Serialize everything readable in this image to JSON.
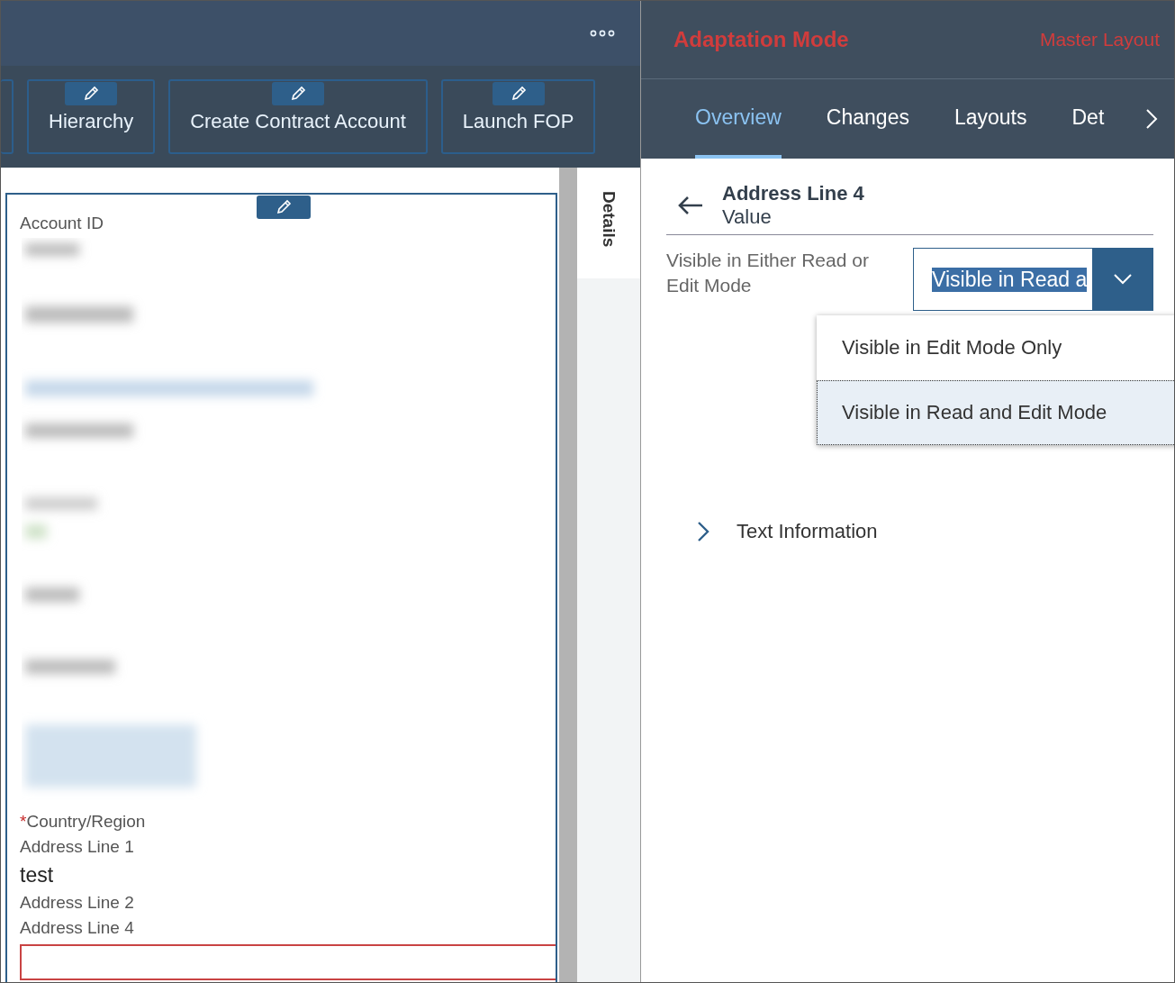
{
  "toolbar": {
    "buttons": [
      {
        "label": "Hierarchy"
      },
      {
        "label": "Create Contract Account"
      },
      {
        "label": "Launch FOP"
      }
    ]
  },
  "card": {
    "fields": [
      {
        "kind": "label",
        "text": "Account ID"
      },
      {
        "kind": "blurred"
      },
      {
        "kind": "required_label",
        "mark": "*",
        "text": "Country/Region"
      },
      {
        "kind": "label",
        "text": "Address Line 1"
      },
      {
        "kind": "value",
        "text": "test"
      },
      {
        "kind": "label",
        "text": "Address Line 2"
      },
      {
        "kind": "label",
        "text": "Address Line 4"
      },
      {
        "kind": "input",
        "error": true
      }
    ]
  },
  "side_tab": {
    "label": "Details"
  },
  "adaptation": {
    "title": "Adaptation Mode",
    "layout": "Master Layout",
    "tabs": [
      {
        "label": "Overview",
        "selected": true
      },
      {
        "label": "Changes",
        "selected": false
      },
      {
        "label": "Layouts",
        "selected": false
      },
      {
        "label": "Det",
        "selected": false
      }
    ],
    "heading": "Address Line 4",
    "subheading": "Value",
    "setting_label": "Visible in Either Read or Edit Mode",
    "select_value": "Visible in Read a",
    "options": [
      {
        "label": "Visible in Edit Mode Only",
        "selected": false
      },
      {
        "label": "Visible in Read and Edit Mode",
        "selected": true
      }
    ],
    "sections": [
      {
        "label": "Text Information",
        "expanded": false
      }
    ]
  }
}
